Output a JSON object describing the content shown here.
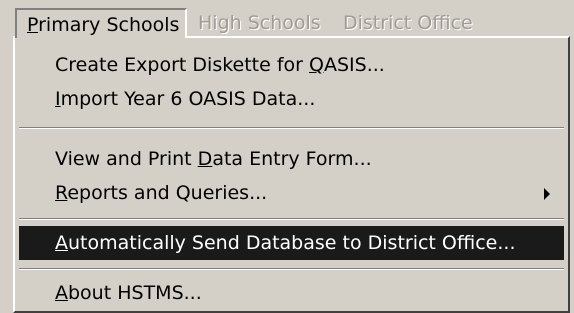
{
  "menubar": {
    "items": [
      {
        "label": "Primary Schools",
        "state": "open"
      },
      {
        "label": "High Schools",
        "state": "disabled"
      },
      {
        "label": "District Office",
        "state": "disabled"
      }
    ]
  },
  "menu": {
    "items": [
      {
        "pre": "Create Export Diskette for ",
        "mn": "Q",
        "post": "ASIS..."
      },
      {
        "pre": "",
        "mn": "I",
        "post": "mport Year 6 OASIS Data..."
      },
      {
        "pre": "View and Print ",
        "mn": "D",
        "post": "ata Entry Form..."
      },
      {
        "pre": "",
        "mn": "R",
        "post": "eports and Queries...",
        "submenu": true,
        "arrow_icon": "submenu-arrow-icon"
      },
      {
        "pre": "",
        "mn": "A",
        "post": "utomatically Send Database to District Office...",
        "selected": true
      },
      {
        "pre": "",
        "mn": "A",
        "post": "bout HSTMS..."
      }
    ]
  },
  "colors": {
    "face": "#d4d0c8",
    "highlight_bg": "#1a1a1a",
    "highlight_text": "#ffffff",
    "disabled_text": "#a09c95"
  }
}
